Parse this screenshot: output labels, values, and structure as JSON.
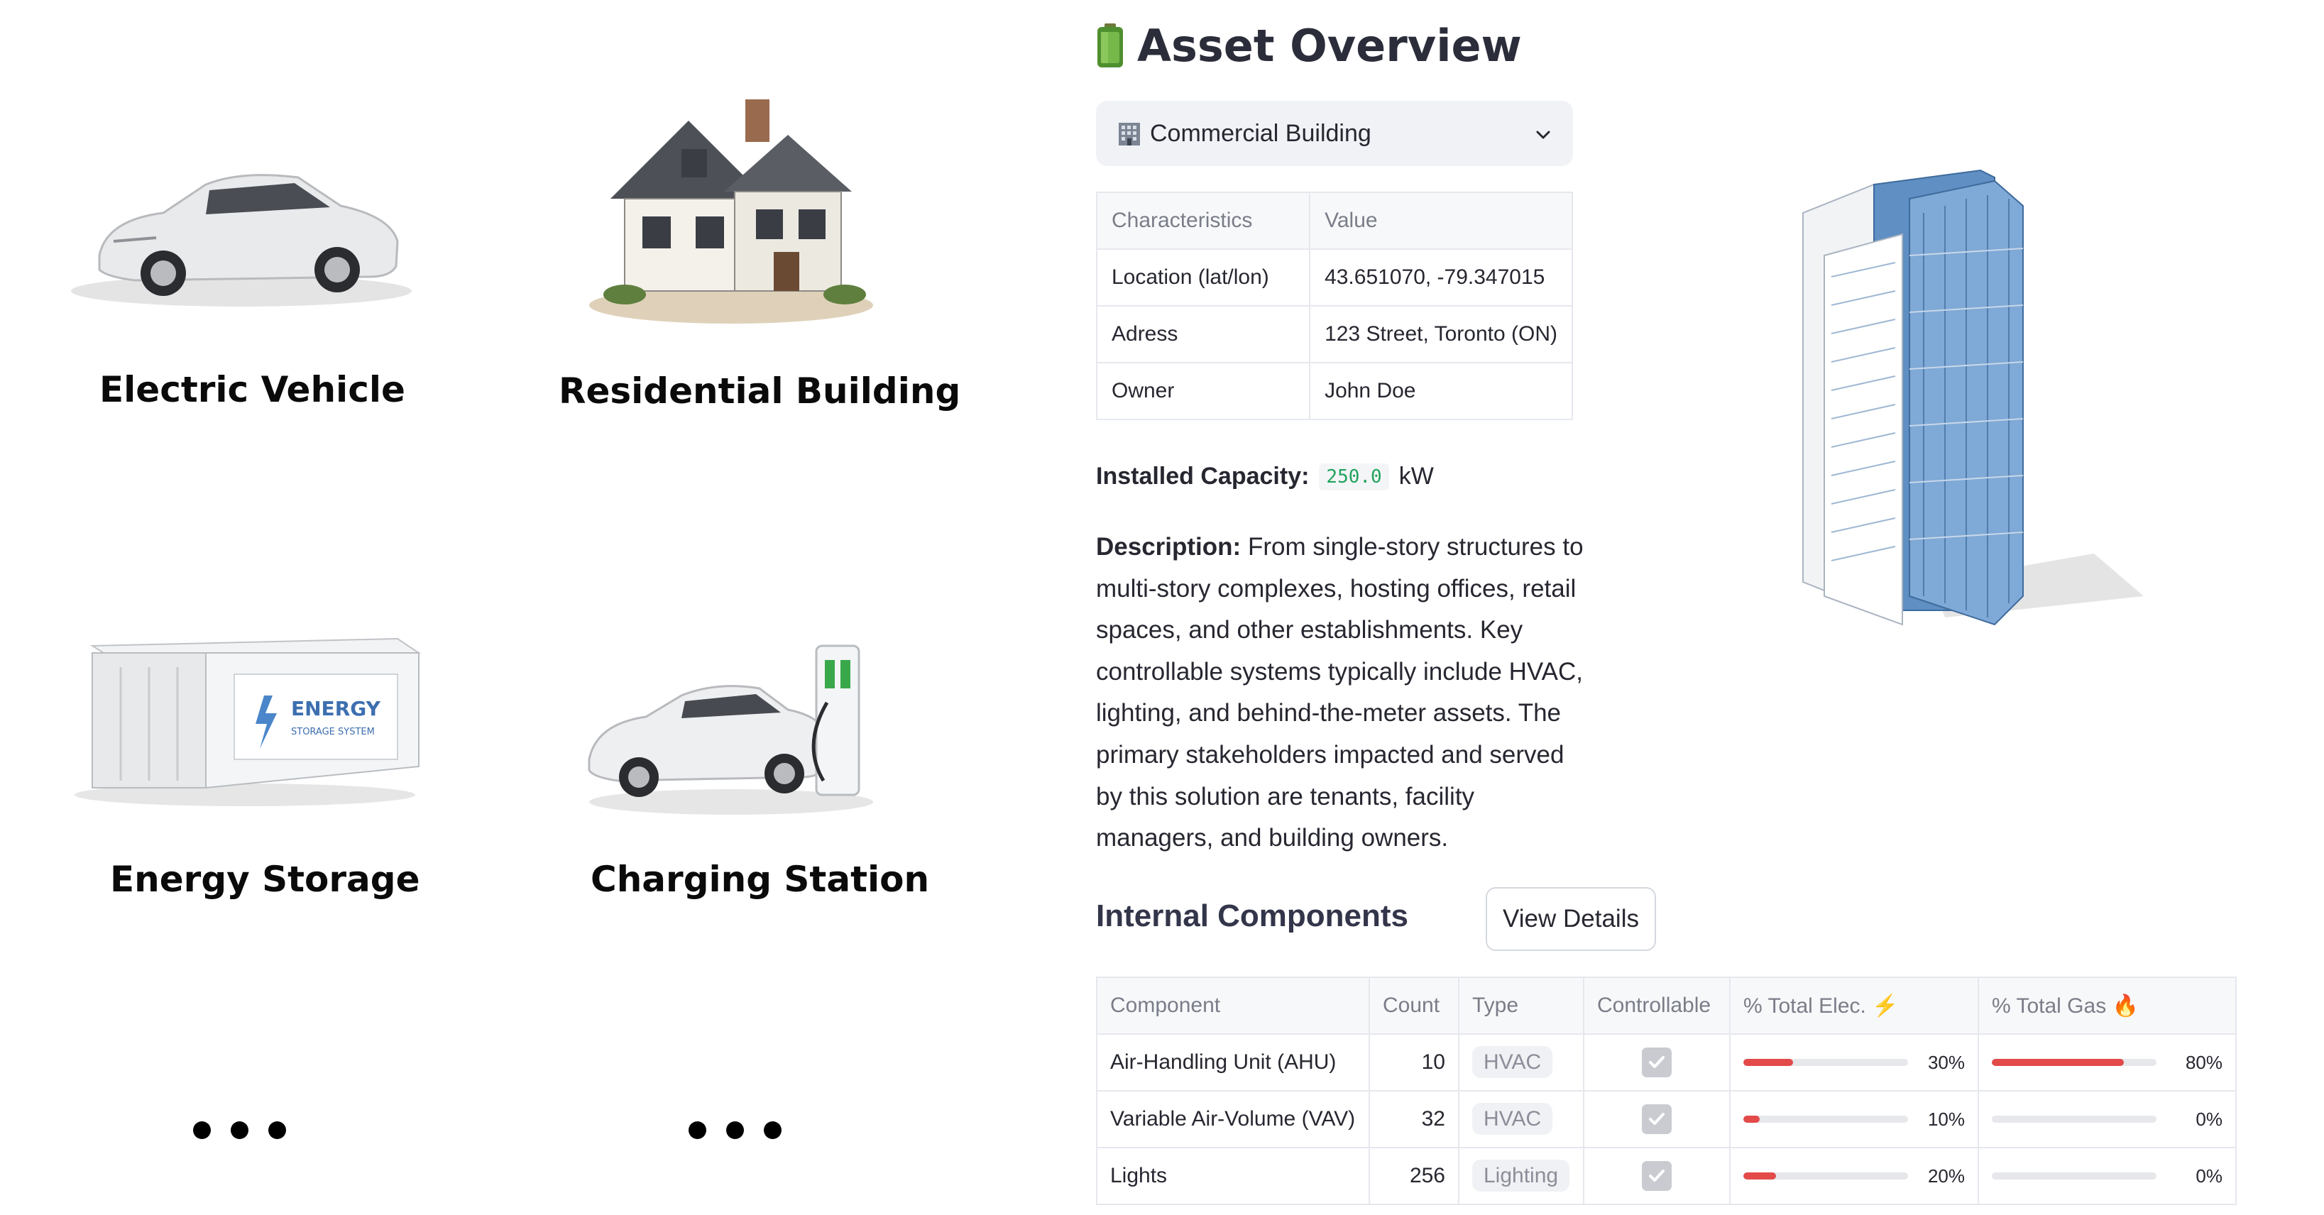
{
  "gallery": {
    "items": [
      {
        "label": "Electric Vehicle"
      },
      {
        "label": "Residential Building"
      },
      {
        "label": "Energy Storage"
      },
      {
        "label": "Charging Station"
      }
    ],
    "storage_text": "ENERGY",
    "storage_subtext": "STORAGE SYSTEM"
  },
  "panel": {
    "title": "Asset Overview",
    "title_icon": "battery-icon",
    "select": {
      "icon": "office-building-icon",
      "value": "Commercial Building"
    },
    "characteristics": {
      "headers": [
        "Characteristics",
        "Value"
      ],
      "rows": [
        [
          "Location (lat/lon)",
          "43.651070, -79.347015"
        ],
        [
          "Adress",
          "123 Street, Toronto (ON)"
        ],
        [
          "Owner",
          "John Doe"
        ]
      ]
    },
    "capacity": {
      "label": "Installed Capacity:",
      "value": "250.0",
      "unit": "kW"
    },
    "description": {
      "label": "Description:",
      "text": "From single-story structures to multi-story complexes, hosting offices, retail spaces, and other establishments. Key controllable systems typically include HVAC, lighting, and behind-the-meter assets. The primary stakeholders impacted and served by this solution are tenants, facility managers, and building owners."
    },
    "components": {
      "title": "Internal Components",
      "button": "View Details",
      "headers": [
        "Component",
        "Count",
        "Type",
        "Controllable",
        "% Total Elec. ⚡",
        "% Total Gas 🔥"
      ],
      "rows": [
        {
          "name": "Air-Handling Unit (AHU)",
          "count": "10",
          "type": "HVAC",
          "controllable": true,
          "elec": "30%",
          "elec_value": 0.3,
          "gas": "80%",
          "gas_value": 0.8
        },
        {
          "name": "Variable Air-Volume (VAV)",
          "count": "32",
          "type": "HVAC",
          "controllable": true,
          "elec": "10%",
          "elec_value": 0.1,
          "gas": "0%",
          "gas_value": 0.0
        },
        {
          "name": "Lights",
          "count": "256",
          "type": "Lighting",
          "controllable": true,
          "elec": "20%",
          "elec_value": 0.2,
          "gas": "0%",
          "gas_value": 0.0
        }
      ]
    }
  },
  "colors": {
    "accent_bar": "#e34a4a",
    "code_text": "#21a35b"
  }
}
